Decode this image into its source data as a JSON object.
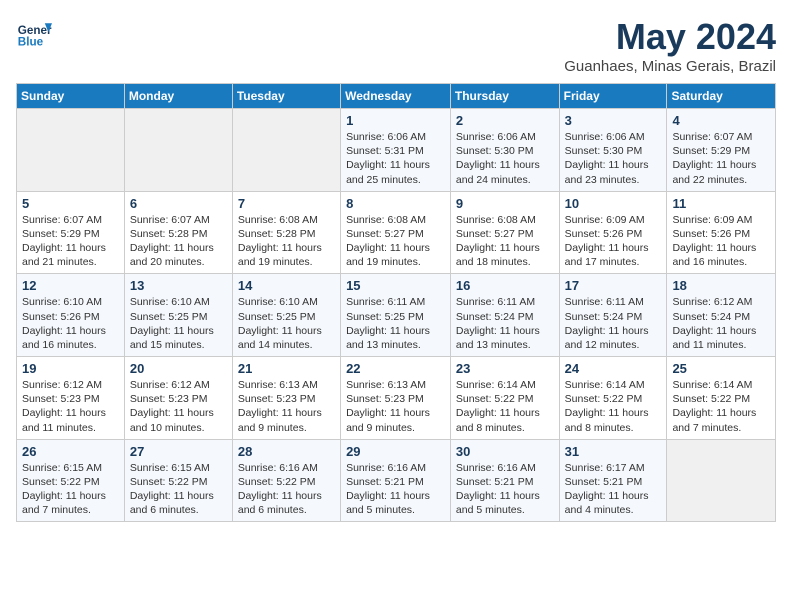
{
  "header": {
    "logo_line1": "General",
    "logo_line2": "Blue",
    "month": "May 2024",
    "location": "Guanhaes, Minas Gerais, Brazil"
  },
  "weekdays": [
    "Sunday",
    "Monday",
    "Tuesday",
    "Wednesday",
    "Thursday",
    "Friday",
    "Saturday"
  ],
  "weeks": [
    [
      {
        "day": "",
        "info": ""
      },
      {
        "day": "",
        "info": ""
      },
      {
        "day": "",
        "info": ""
      },
      {
        "day": "1",
        "info": "Sunrise: 6:06 AM\nSunset: 5:31 PM\nDaylight: 11 hours\nand 25 minutes."
      },
      {
        "day": "2",
        "info": "Sunrise: 6:06 AM\nSunset: 5:30 PM\nDaylight: 11 hours\nand 24 minutes."
      },
      {
        "day": "3",
        "info": "Sunrise: 6:06 AM\nSunset: 5:30 PM\nDaylight: 11 hours\nand 23 minutes."
      },
      {
        "day": "4",
        "info": "Sunrise: 6:07 AM\nSunset: 5:29 PM\nDaylight: 11 hours\nand 22 minutes."
      }
    ],
    [
      {
        "day": "5",
        "info": "Sunrise: 6:07 AM\nSunset: 5:29 PM\nDaylight: 11 hours\nand 21 minutes."
      },
      {
        "day": "6",
        "info": "Sunrise: 6:07 AM\nSunset: 5:28 PM\nDaylight: 11 hours\nand 20 minutes."
      },
      {
        "day": "7",
        "info": "Sunrise: 6:08 AM\nSunset: 5:28 PM\nDaylight: 11 hours\nand 19 minutes."
      },
      {
        "day": "8",
        "info": "Sunrise: 6:08 AM\nSunset: 5:27 PM\nDaylight: 11 hours\nand 19 minutes."
      },
      {
        "day": "9",
        "info": "Sunrise: 6:08 AM\nSunset: 5:27 PM\nDaylight: 11 hours\nand 18 minutes."
      },
      {
        "day": "10",
        "info": "Sunrise: 6:09 AM\nSunset: 5:26 PM\nDaylight: 11 hours\nand 17 minutes."
      },
      {
        "day": "11",
        "info": "Sunrise: 6:09 AM\nSunset: 5:26 PM\nDaylight: 11 hours\nand 16 minutes."
      }
    ],
    [
      {
        "day": "12",
        "info": "Sunrise: 6:10 AM\nSunset: 5:26 PM\nDaylight: 11 hours\nand 16 minutes."
      },
      {
        "day": "13",
        "info": "Sunrise: 6:10 AM\nSunset: 5:25 PM\nDaylight: 11 hours\nand 15 minutes."
      },
      {
        "day": "14",
        "info": "Sunrise: 6:10 AM\nSunset: 5:25 PM\nDaylight: 11 hours\nand 14 minutes."
      },
      {
        "day": "15",
        "info": "Sunrise: 6:11 AM\nSunset: 5:25 PM\nDaylight: 11 hours\nand 13 minutes."
      },
      {
        "day": "16",
        "info": "Sunrise: 6:11 AM\nSunset: 5:24 PM\nDaylight: 11 hours\nand 13 minutes."
      },
      {
        "day": "17",
        "info": "Sunrise: 6:11 AM\nSunset: 5:24 PM\nDaylight: 11 hours\nand 12 minutes."
      },
      {
        "day": "18",
        "info": "Sunrise: 6:12 AM\nSunset: 5:24 PM\nDaylight: 11 hours\nand 11 minutes."
      }
    ],
    [
      {
        "day": "19",
        "info": "Sunrise: 6:12 AM\nSunset: 5:23 PM\nDaylight: 11 hours\nand 11 minutes."
      },
      {
        "day": "20",
        "info": "Sunrise: 6:12 AM\nSunset: 5:23 PM\nDaylight: 11 hours\nand 10 minutes."
      },
      {
        "day": "21",
        "info": "Sunrise: 6:13 AM\nSunset: 5:23 PM\nDaylight: 11 hours\nand 9 minutes."
      },
      {
        "day": "22",
        "info": "Sunrise: 6:13 AM\nSunset: 5:23 PM\nDaylight: 11 hours\nand 9 minutes."
      },
      {
        "day": "23",
        "info": "Sunrise: 6:14 AM\nSunset: 5:22 PM\nDaylight: 11 hours\nand 8 minutes."
      },
      {
        "day": "24",
        "info": "Sunrise: 6:14 AM\nSunset: 5:22 PM\nDaylight: 11 hours\nand 8 minutes."
      },
      {
        "day": "25",
        "info": "Sunrise: 6:14 AM\nSunset: 5:22 PM\nDaylight: 11 hours\nand 7 minutes."
      }
    ],
    [
      {
        "day": "26",
        "info": "Sunrise: 6:15 AM\nSunset: 5:22 PM\nDaylight: 11 hours\nand 7 minutes."
      },
      {
        "day": "27",
        "info": "Sunrise: 6:15 AM\nSunset: 5:22 PM\nDaylight: 11 hours\nand 6 minutes."
      },
      {
        "day": "28",
        "info": "Sunrise: 6:16 AM\nSunset: 5:22 PM\nDaylight: 11 hours\nand 6 minutes."
      },
      {
        "day": "29",
        "info": "Sunrise: 6:16 AM\nSunset: 5:21 PM\nDaylight: 11 hours\nand 5 minutes."
      },
      {
        "day": "30",
        "info": "Sunrise: 6:16 AM\nSunset: 5:21 PM\nDaylight: 11 hours\nand 5 minutes."
      },
      {
        "day": "31",
        "info": "Sunrise: 6:17 AM\nSunset: 5:21 PM\nDaylight: 11 hours\nand 4 minutes."
      },
      {
        "day": "",
        "info": ""
      }
    ]
  ]
}
